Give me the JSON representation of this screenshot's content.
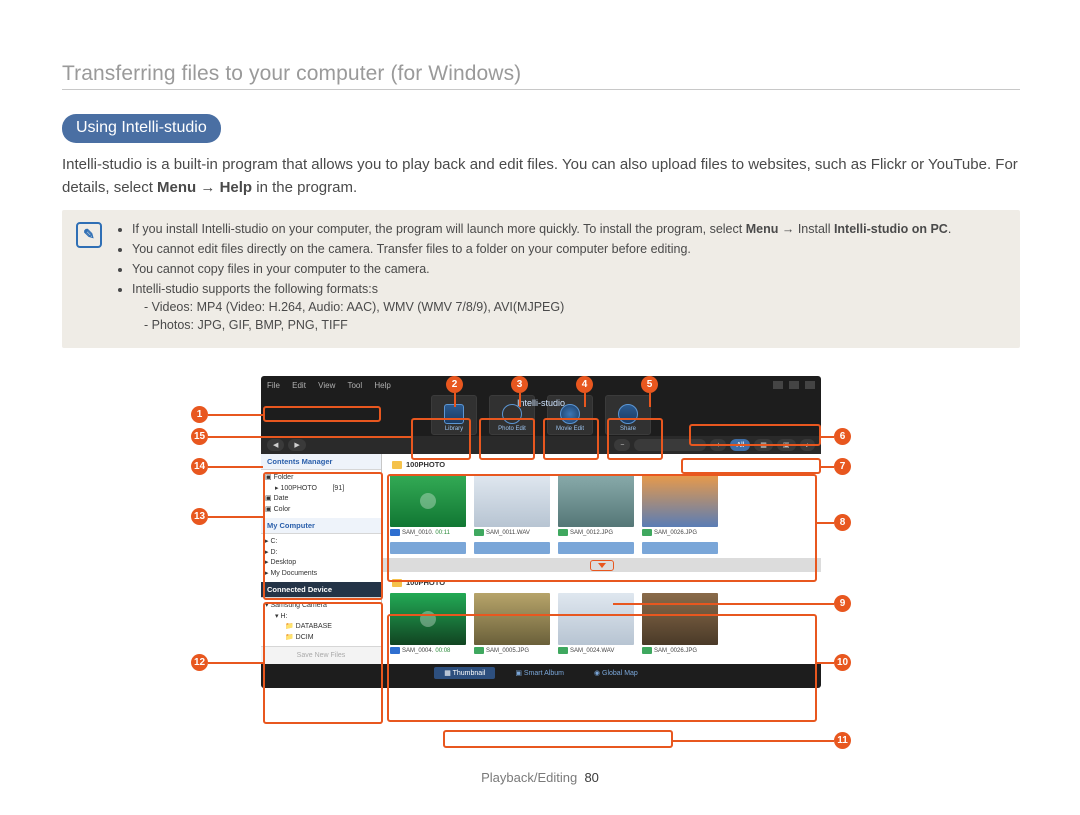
{
  "page": {
    "title": "Transferring files to your computer (for Windows)",
    "section": "Using Intelli-studio",
    "intro_a": "Intelli-studio is a built-in program that allows you to play back and edit files. You can also upload files to websites, such as Flickr or YouTube.",
    "intro_menu": "Menu",
    "intro_help": "Help",
    "intro_tail": "in the program.",
    "footer_section": "Playback/Editing",
    "footer_num": "80"
  },
  "notes": [
    {
      "pre": "If you install Intelli-studio on your computer, the program will launch more quickly. To install the program, select ",
      "bold1": "Menu",
      "mid": " → Install ",
      "bold2": "Intelli-studio on PC"
    },
    {
      "text": "You cannot edit files directly on the camera. Transfer files to a folder on your computer before editing."
    },
    {
      "text": "You cannot copy files in your computer to the camera."
    },
    {
      "text": "Intelli-studio supports the following formats:s",
      "sub1": "- Videos: MP4 (Video: H.264, Audio: AAC), WMV (WMV 7/8/9), AVI(MJPEG)",
      "sub2": "- Photos: JPG, GIF, BMP, PNG, TIFF"
    }
  ],
  "callouts": [
    "1",
    "2",
    "3",
    "4",
    "5",
    "6",
    "7",
    "8",
    "9",
    "10",
    "11",
    "12",
    "13",
    "14",
    "15"
  ],
  "app": {
    "brand": "Intelli-studio",
    "menu": [
      "File",
      "Edit",
      "View",
      "Tool",
      "Help"
    ],
    "toolbar": [
      "Library",
      "Photo Edit",
      "Movie Edit",
      "Share"
    ],
    "filters": [
      "All"
    ],
    "side": {
      "contents": "Contents Manager",
      "folder": "Folder",
      "folder_item": "100PHOTO",
      "folder_count": "[91]",
      "date": "Date",
      "color": "Color",
      "mycomp": "My Computer",
      "drives": [
        "C:",
        "D:",
        "Desktop",
        "My Documents"
      ],
      "connected": "Connected Device",
      "device": [
        "Samsung Camera",
        "H:",
        "DATABASE",
        "DCIM"
      ],
      "save": "Save New Files"
    },
    "pane1": {
      "title": "100PHOTO",
      "items": [
        {
          "name": "SAM_0010.",
          "dur": "00:11"
        },
        {
          "name": "SAM_0011.WAV"
        },
        {
          "name": "SAM_0012.JPG"
        },
        {
          "name": "SAM_0026.JPG"
        }
      ]
    },
    "pane2": {
      "title": "100PHOTO",
      "items": [
        {
          "name": "SAM_0004.",
          "dur": "00:08"
        },
        {
          "name": "SAM_0005.JPG"
        },
        {
          "name": "SAM_0024.WAV"
        },
        {
          "name": "SAM_0026.JPG"
        }
      ]
    },
    "tabs": [
      "Thumbnail",
      "Smart Album",
      "Global Map"
    ]
  }
}
